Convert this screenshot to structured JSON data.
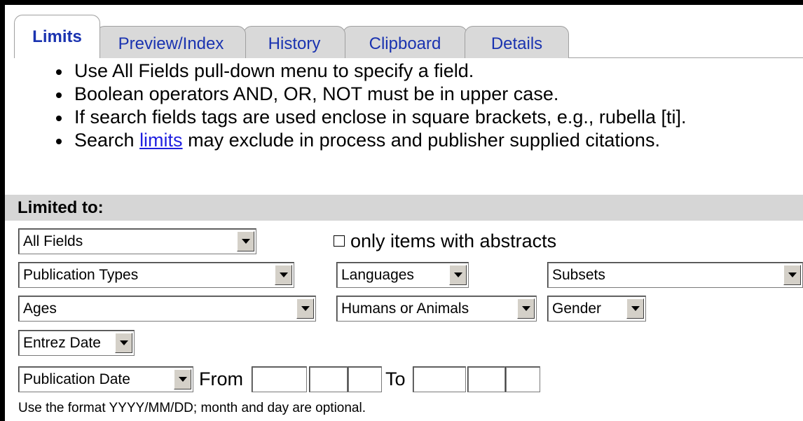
{
  "tabs": [
    {
      "label": "Limits",
      "active": true
    },
    {
      "label": "Preview/Index",
      "active": false
    },
    {
      "label": "History",
      "active": false
    },
    {
      "label": "Clipboard",
      "active": false
    },
    {
      "label": "Details",
      "active": false
    }
  ],
  "tips": {
    "line1": "Use All Fields pull-down menu to specify a field.",
    "line2": "Boolean operators AND, OR, NOT must be in upper case.",
    "line3": "If search fields tags are used enclose in square brackets, e.g., rubella [ti].",
    "line4_pre": "Search ",
    "line4_link": "limits",
    "line4_post": " may exclude in process and publisher supplied citations."
  },
  "limits": {
    "section_title": "Limited to:",
    "field_select": "All Fields",
    "abstracts_label": "only items with abstracts",
    "abstracts_checked": false,
    "publication_types": "Publication Types",
    "languages": "Languages",
    "subsets": "Subsets",
    "ages": "Ages",
    "humans_or_animals": "Humans or Animals",
    "gender": "Gender",
    "entrez_date": "Entrez Date",
    "publication_date": "Publication Date",
    "from_label": "From",
    "to_label": "To",
    "from_year": "",
    "from_month": "",
    "from_day": "",
    "to_year": "",
    "to_month": "",
    "to_day": "",
    "format_hint": "Use the format YYYY/MM/DD; month and day are optional."
  },
  "colors": {
    "tab_text": "#1a33b0",
    "tab_inactive_bg": "#d9d9d9",
    "section_bar": "#d6d6d6",
    "link": "#1f1fe0",
    "frame": "#000000"
  }
}
